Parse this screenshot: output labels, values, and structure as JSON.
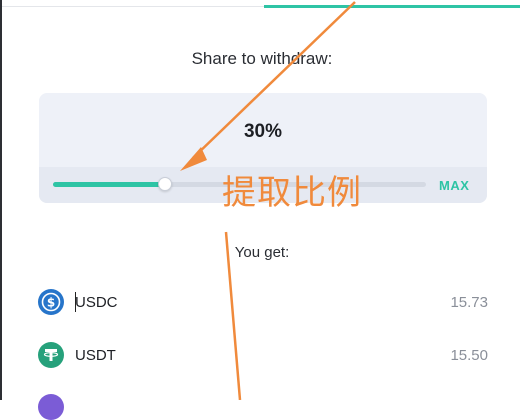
{
  "header": {
    "share_title": "Share to withdraw:"
  },
  "withdraw": {
    "percent_label": "30%",
    "share_fraction": 0.3,
    "max_label": "MAX"
  },
  "annotation": {
    "text": "提取比例",
    "color": "#f08a3c"
  },
  "receive": {
    "title": "You get:",
    "tokens": [
      {
        "symbol": "USDC",
        "amount": "15.73",
        "icon": "usdc-icon"
      },
      {
        "symbol": "USDT",
        "amount": "15.50",
        "icon": "usdt-icon"
      },
      {
        "symbol": "",
        "amount": "",
        "icon": "token-icon"
      }
    ]
  },
  "colors": {
    "accent": "#2ec4a5",
    "usdc": "#2775ca",
    "usdt": "#26a17b"
  }
}
